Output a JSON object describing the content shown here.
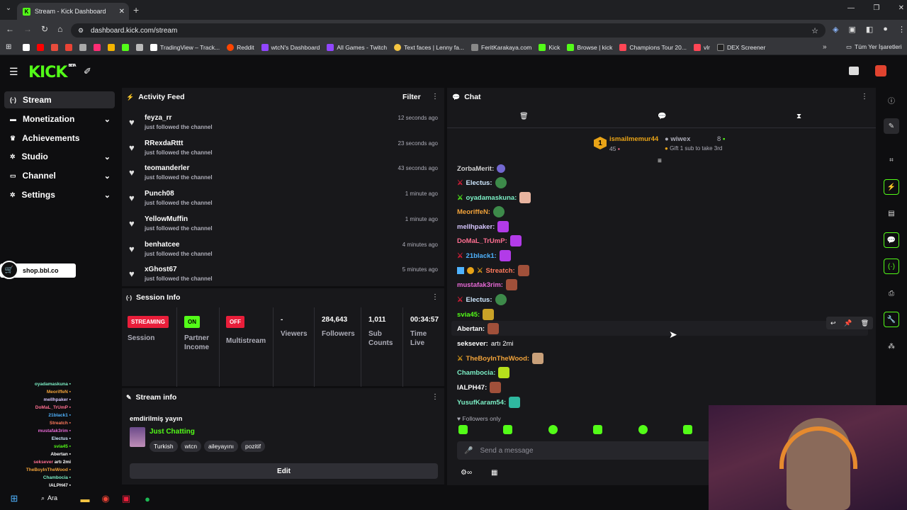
{
  "browser": {
    "tab_title": "Stream - Kick Dashboard",
    "url": "dashboard.kick.com/stream",
    "bookmarks": [
      "TradingView – Track...",
      "Reddit",
      "wtcN's Dashboard",
      "All Games - Twitch",
      "Text faces | Lenny fa...",
      "FeritKarakaya.com",
      "Kick",
      "Browse | kick",
      "Champions Tour 20...",
      "vlr",
      "DEX Screener"
    ],
    "all_bookmarks": "Tüm Yer İşaretleri"
  },
  "brand": {
    "logo": "KICK",
    "beta": "BETA",
    "accent": "#53fc18"
  },
  "sidebar": {
    "items": [
      {
        "label": "Stream",
        "icon": "broadcast-icon"
      },
      {
        "label": "Monetization",
        "icon": "money-icon"
      },
      {
        "label": "Achievements",
        "icon": "trophy-icon"
      },
      {
        "label": "Studio",
        "icon": "gear-icon"
      },
      {
        "label": "Channel",
        "icon": "tv-icon"
      },
      {
        "label": "Settings",
        "icon": "settings-icon"
      }
    ],
    "promo": "shop.bbl.co"
  },
  "activity": {
    "title": "Activity Feed",
    "filter": "Filter",
    "items": [
      {
        "name": "feyza_rr",
        "action": "just followed the channel",
        "time": "12 seconds ago"
      },
      {
        "name": "RRexdaRttt",
        "action": "just followed the channel",
        "time": "23 seconds ago"
      },
      {
        "name": "teomanderler",
        "action": "just followed the channel",
        "time": "43 seconds ago"
      },
      {
        "name": "Punch08",
        "action": "just followed the channel",
        "time": "1 minute ago"
      },
      {
        "name": "YellowMuffin",
        "action": "just followed the channel",
        "time": "1 minute ago"
      },
      {
        "name": "benhatcee",
        "action": "just followed the channel",
        "time": "4 minutes ago"
      },
      {
        "name": "xGhost67",
        "action": "just followed the channel",
        "time": "5 minutes ago"
      }
    ]
  },
  "session": {
    "title": "Session Info",
    "streaming": "STREAMING",
    "session_label": "Session",
    "on": "ON",
    "partner_label": "Partner Income",
    "off": "OFF",
    "multistream_label": "Multistream",
    "viewers_value": "-",
    "viewers_label": "Viewers",
    "followers_value": "284,643",
    "followers_label": "Followers",
    "subs_value": "1,011",
    "subs_label": "Sub Counts",
    "time_value": "00:34:57",
    "time_label": "Time Live"
  },
  "streaminfo": {
    "title": "Stream info",
    "stream_title": "emdirilmiş yayın",
    "category": "Just Chatting",
    "tags": [
      "Turkish",
      "wtcn",
      "aileyayını",
      "pozitif"
    ],
    "edit": "Edit"
  },
  "chat": {
    "title": "Chat",
    "top_gifter": {
      "rank": "1",
      "name": "ismailmemur44",
      "count": "45"
    },
    "second_gifter": {
      "name": "wiwex",
      "count": "8",
      "note": "Gift 1 sub to take 3rd"
    },
    "messages": [
      {
        "user": "ZorbaMerit:",
        "color": "#ffffff",
        "text": ""
      },
      {
        "user": "Electus:",
        "color": "#cfe8ff",
        "text": ""
      },
      {
        "user": "oyadamaskuna:",
        "color": "#7cf0c6",
        "text": ""
      },
      {
        "user": "MeoriffeN:",
        "color": "#f2a33a",
        "text": ""
      },
      {
        "user": "mellhpaker:",
        "color": "#d7c7ff",
        "text": ""
      },
      {
        "user": "DoMaL_TrUmP:",
        "color": "#ff6f91",
        "text": ""
      },
      {
        "user": "21black1:",
        "color": "#4fb3ff",
        "text": ""
      },
      {
        "user": "Streatch:",
        "color": "#ff7a5c",
        "text": ""
      },
      {
        "user": "mustafak3rim:",
        "color": "#e86ad6",
        "text": ""
      },
      {
        "user": "Electus:",
        "color": "#cfe8ff",
        "text": ""
      },
      {
        "user": "svia45:",
        "color": "#53fc18",
        "text": ""
      },
      {
        "user": "Abertan:",
        "color": "#ffffff",
        "text": ""
      },
      {
        "user": "seksever:",
        "color": "#ffffff",
        "text": "artı 2mi"
      },
      {
        "user": "TheBoyInTheWood:",
        "color": "#f2a33a",
        "text": ""
      },
      {
        "user": "Chambocia:",
        "color": "#7cf0c6",
        "text": ""
      },
      {
        "user": "IALPH47:",
        "color": "#ffffff",
        "text": ""
      },
      {
        "user": "YusufKaram54:",
        "color": "#7cf0c6",
        "text": ""
      }
    ],
    "followers_only": "Followers only",
    "placeholder": "Send a message"
  },
  "overlay": {
    "users": [
      "oyadamaskuna",
      "MeoriffeN",
      "mellhpaker",
      "DoMaL_TrUmP",
      "21black1",
      "Streatch",
      "mustafak3rim",
      "Electus",
      "svia45",
      "Abertan",
      "seksever",
      "TheBoyInTheWood",
      "Chambocia",
      "IALPH47",
      "YusufKaram54"
    ],
    "seksever_text": "artı 2mi"
  },
  "taskbar": {
    "search": "Ara"
  }
}
